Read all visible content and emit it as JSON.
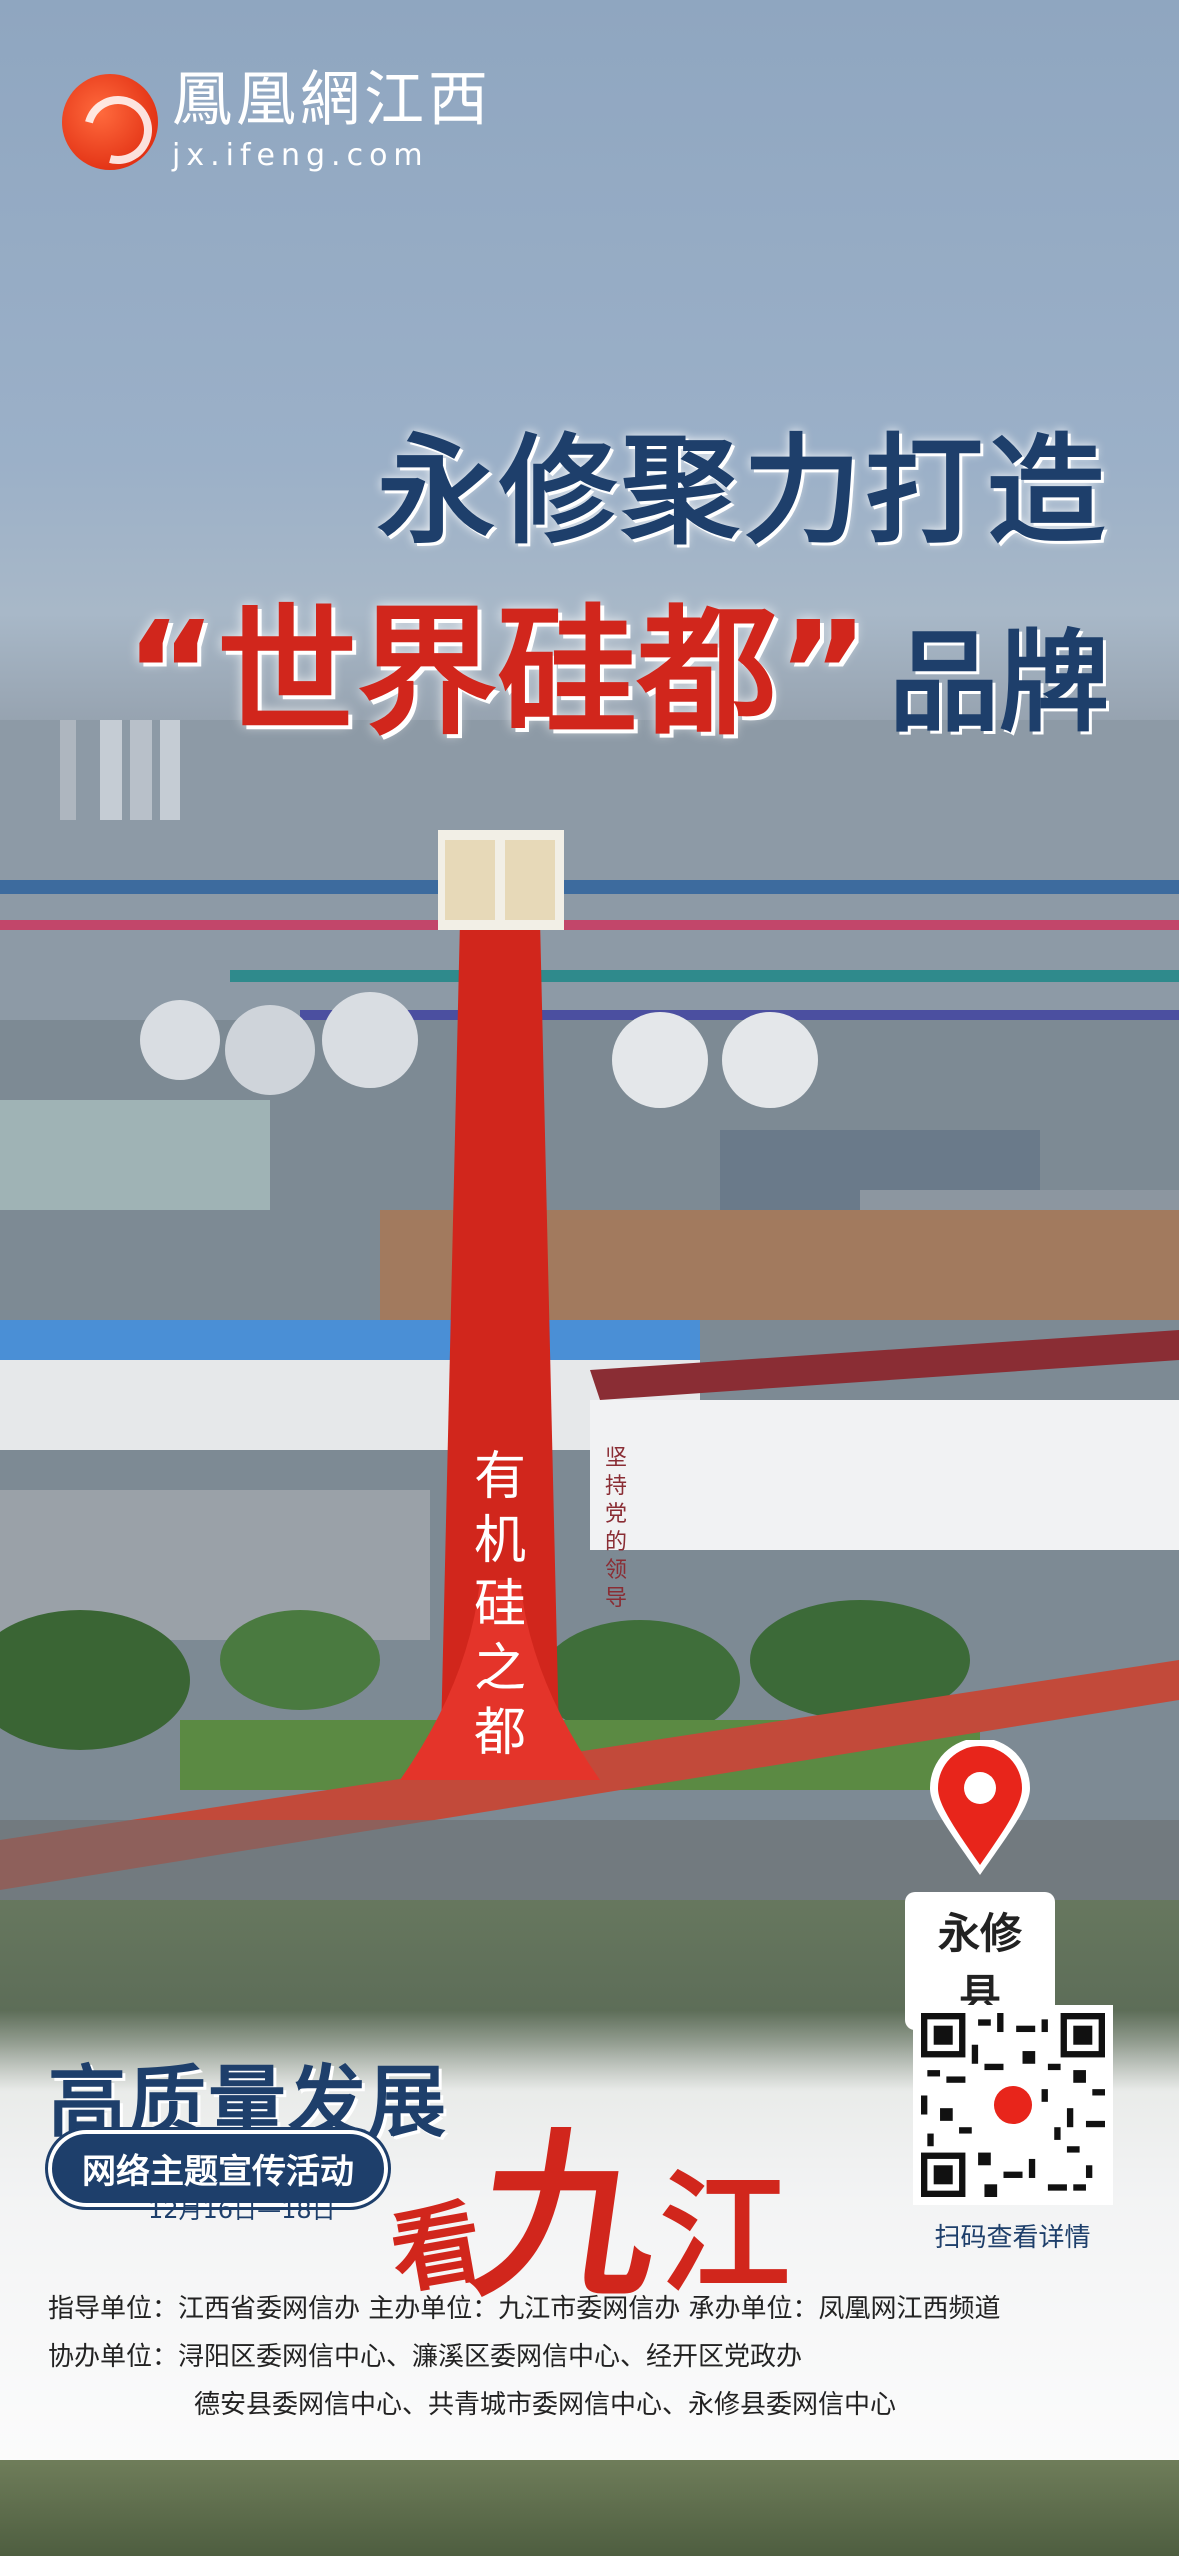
{
  "logo": {
    "cn": "鳳凰網江西",
    "en": "jx.ifeng.com"
  },
  "headline": {
    "line1": "永修聚力打造",
    "line2_red": "“世界硅都”",
    "line2_blue": "品牌"
  },
  "monument": {
    "text": "有机硅之都"
  },
  "building_sign": {
    "vertical": "坚持党的领导"
  },
  "location_pin": {
    "label": "永修县",
    "color": "#e8251b"
  },
  "campaign": {
    "title": "高质量发展",
    "pill": "网络主题宣传活动",
    "date": "12月16日—18日",
    "kan": "看",
    "jiu": "九",
    "jiang": "江"
  },
  "qr": {
    "caption": "扫码查看详情"
  },
  "credits": {
    "row1": "指导单位：江西省委网信办    主办单位：九江市委网信办    承办单位：凤凰网江西频道",
    "row2": "协办单位：浔阳区委网信中心、濂溪区委网信中心、经开区党政办",
    "row3": "德安县委网信中心、共青城市委网信中心、永修县委网信中心"
  },
  "colors": {
    "navy": "#1e3f6b",
    "red": "#d1261c"
  }
}
